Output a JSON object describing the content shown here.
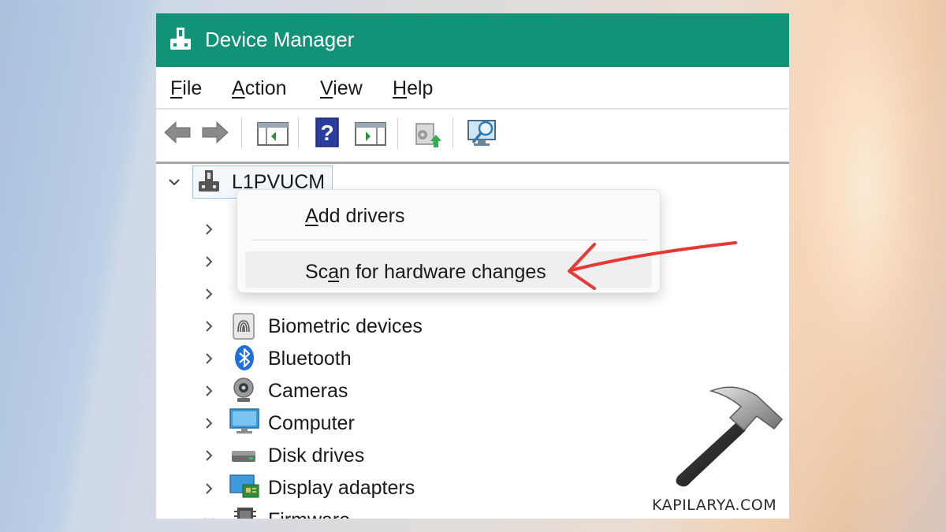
{
  "window": {
    "title": "Device Manager",
    "title_bar_color": "#129277"
  },
  "menu": [
    {
      "label": "File",
      "underline": "F",
      "rest": "ile"
    },
    {
      "label": "Action",
      "underline": "A",
      "rest": "ction"
    },
    {
      "label": "View",
      "underline": "V",
      "rest": "iew"
    },
    {
      "label": "Help",
      "underline": "H",
      "rest": "elp"
    }
  ],
  "toolbar": {
    "icons": [
      "back-arrow-icon",
      "forward-arrow-icon",
      "show-hide-console-tree-icon",
      "help-icon",
      "action-pane-icon",
      "update-driver-icon",
      "scan-monitor-icon"
    ]
  },
  "tree": {
    "root": {
      "label": "L1PVUCM",
      "expanded": true
    },
    "items": [
      {
        "label": "Biometric devices",
        "icon": "fingerprint-icon",
        "expanded": false
      },
      {
        "label": "Bluetooth",
        "icon": "bluetooth-icon",
        "expanded": false
      },
      {
        "label": "Cameras",
        "icon": "camera-icon",
        "expanded": false
      },
      {
        "label": "Computer",
        "icon": "computer-icon",
        "expanded": false
      },
      {
        "label": "Disk drives",
        "icon": "disk-drive-icon",
        "expanded": false
      },
      {
        "label": "Display adapters",
        "icon": "display-adapter-icon",
        "expanded": false
      },
      {
        "label": "Firmware",
        "icon": "firmware-chip-icon",
        "expanded": true
      }
    ]
  },
  "context_menu": {
    "items": [
      {
        "label": "Add drivers",
        "pre": "",
        "underline": "A",
        "post": "dd drivers"
      },
      {
        "label": "Scan for hardware changes",
        "pre": "Sc",
        "underline": "a",
        "post": "n for hardware changes",
        "highlighted": true
      }
    ]
  },
  "annotation": {
    "arrow_color": "#e53935"
  },
  "watermark": "KAPILARYA.COM"
}
